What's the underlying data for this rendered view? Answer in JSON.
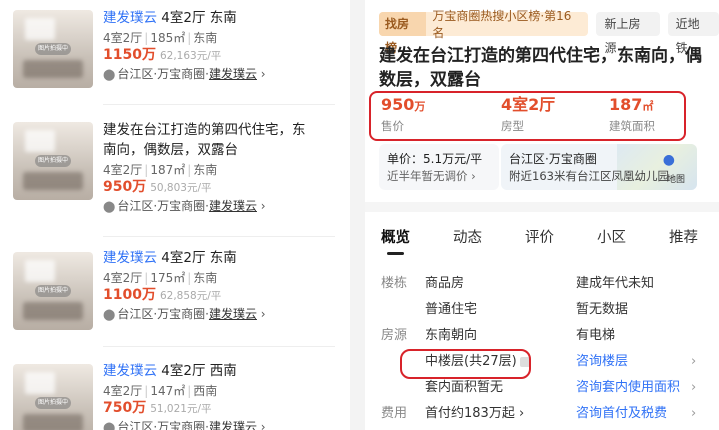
{
  "listings": [
    {
      "community": "建发璞云",
      "layout_title": "4室2厅",
      "orient_title": "东南",
      "meta": [
        "4室2厅",
        "185㎡",
        "东南"
      ],
      "price": "1150万",
      "unit_price": "62,163元/平",
      "location": "台江区·万宝商圈·",
      "location_link": "建发璞云",
      "thumb_stamp": "图片拍摄中"
    },
    {
      "title": "建发在台江打造的第四代住宅，东南向，偶数层，双露台",
      "meta": [
        "4室2厅",
        "187㎡",
        "东南"
      ],
      "price": "950万",
      "unit_price": "50,803元/平",
      "location": "台江区·万宝商圈·",
      "location_link": "建发璞云",
      "thumb_stamp": "图片拍摄中"
    },
    {
      "community": "建发璞云",
      "layout_title": "4室2厅",
      "orient_title": "东南",
      "meta": [
        "4室2厅",
        "175㎡",
        "东南"
      ],
      "price": "1100万",
      "unit_price": "62,858元/平",
      "location": "台江区·万宝商圈·",
      "location_link": "建发璞云",
      "thumb_stamp": "图片拍摄中"
    },
    {
      "community": "建发璞云",
      "layout_title": "4室2厅",
      "orient_title": "西南",
      "meta": [
        "4室2厅",
        "147㎡",
        "西南"
      ],
      "price": "750万",
      "unit_price": "51,021元/平",
      "location": "台江区·万宝商圈·",
      "location_link": "建发璞云",
      "thumb_stamp": "图片拍摄中"
    }
  ],
  "detail": {
    "rank_label": "找房榜",
    "rank_text": "万宝商圈热搜小区榜·第16名",
    "chips": [
      "新上房源",
      "近地铁"
    ],
    "title": "建发在台江打造的第四代住宅，东南向，偶数层，双露台",
    "stats": [
      {
        "value": "950",
        "unit": "万",
        "label": "售价"
      },
      {
        "value": "4室2厅",
        "unit": "",
        "label": "房型"
      },
      {
        "value": "187",
        "unit": "㎡",
        "label": "建筑面积"
      }
    ],
    "unit_price": "单价：5.1万元/平",
    "price_note": "近半年暂无调价",
    "area_name": "台江区·万宝商圈",
    "area_note": "附近163米有台江区凤凰幼儿园",
    "map_label": "地图",
    "tabs": [
      "概览",
      "动态",
      "评价",
      "小区",
      "推荐"
    ],
    "rows": [
      {
        "label": "楼栋",
        "c1": "商品房",
        "c2": "建成年代未知",
        "c2_link": false,
        "arrow": ""
      },
      {
        "label": "",
        "c1": "普通住宅",
        "c2": "暂无数据",
        "c2_link": false,
        "arrow": ""
      },
      {
        "label": "房源",
        "c1": "东南朝向",
        "c2": "有电梯",
        "c2_link": false,
        "arrow": ""
      },
      {
        "label": "",
        "c1": "中楼层(共27层)",
        "c2": "咨询楼层",
        "c2_link": true,
        "arrow": "›"
      },
      {
        "label": "",
        "c1": "套内面积暂无",
        "c2": "咨询套内使用面积",
        "c2_link": true,
        "arrow": "›"
      },
      {
        "label": "费用",
        "c1": "首付约183万起 ›",
        "c2": "咨询首付及税费",
        "c2_link": true,
        "arrow": "›"
      }
    ]
  },
  "colors": {
    "accent_red": "#e24e2c",
    "link_blue": "#3072f6",
    "highlight_red": "#d8232a"
  }
}
